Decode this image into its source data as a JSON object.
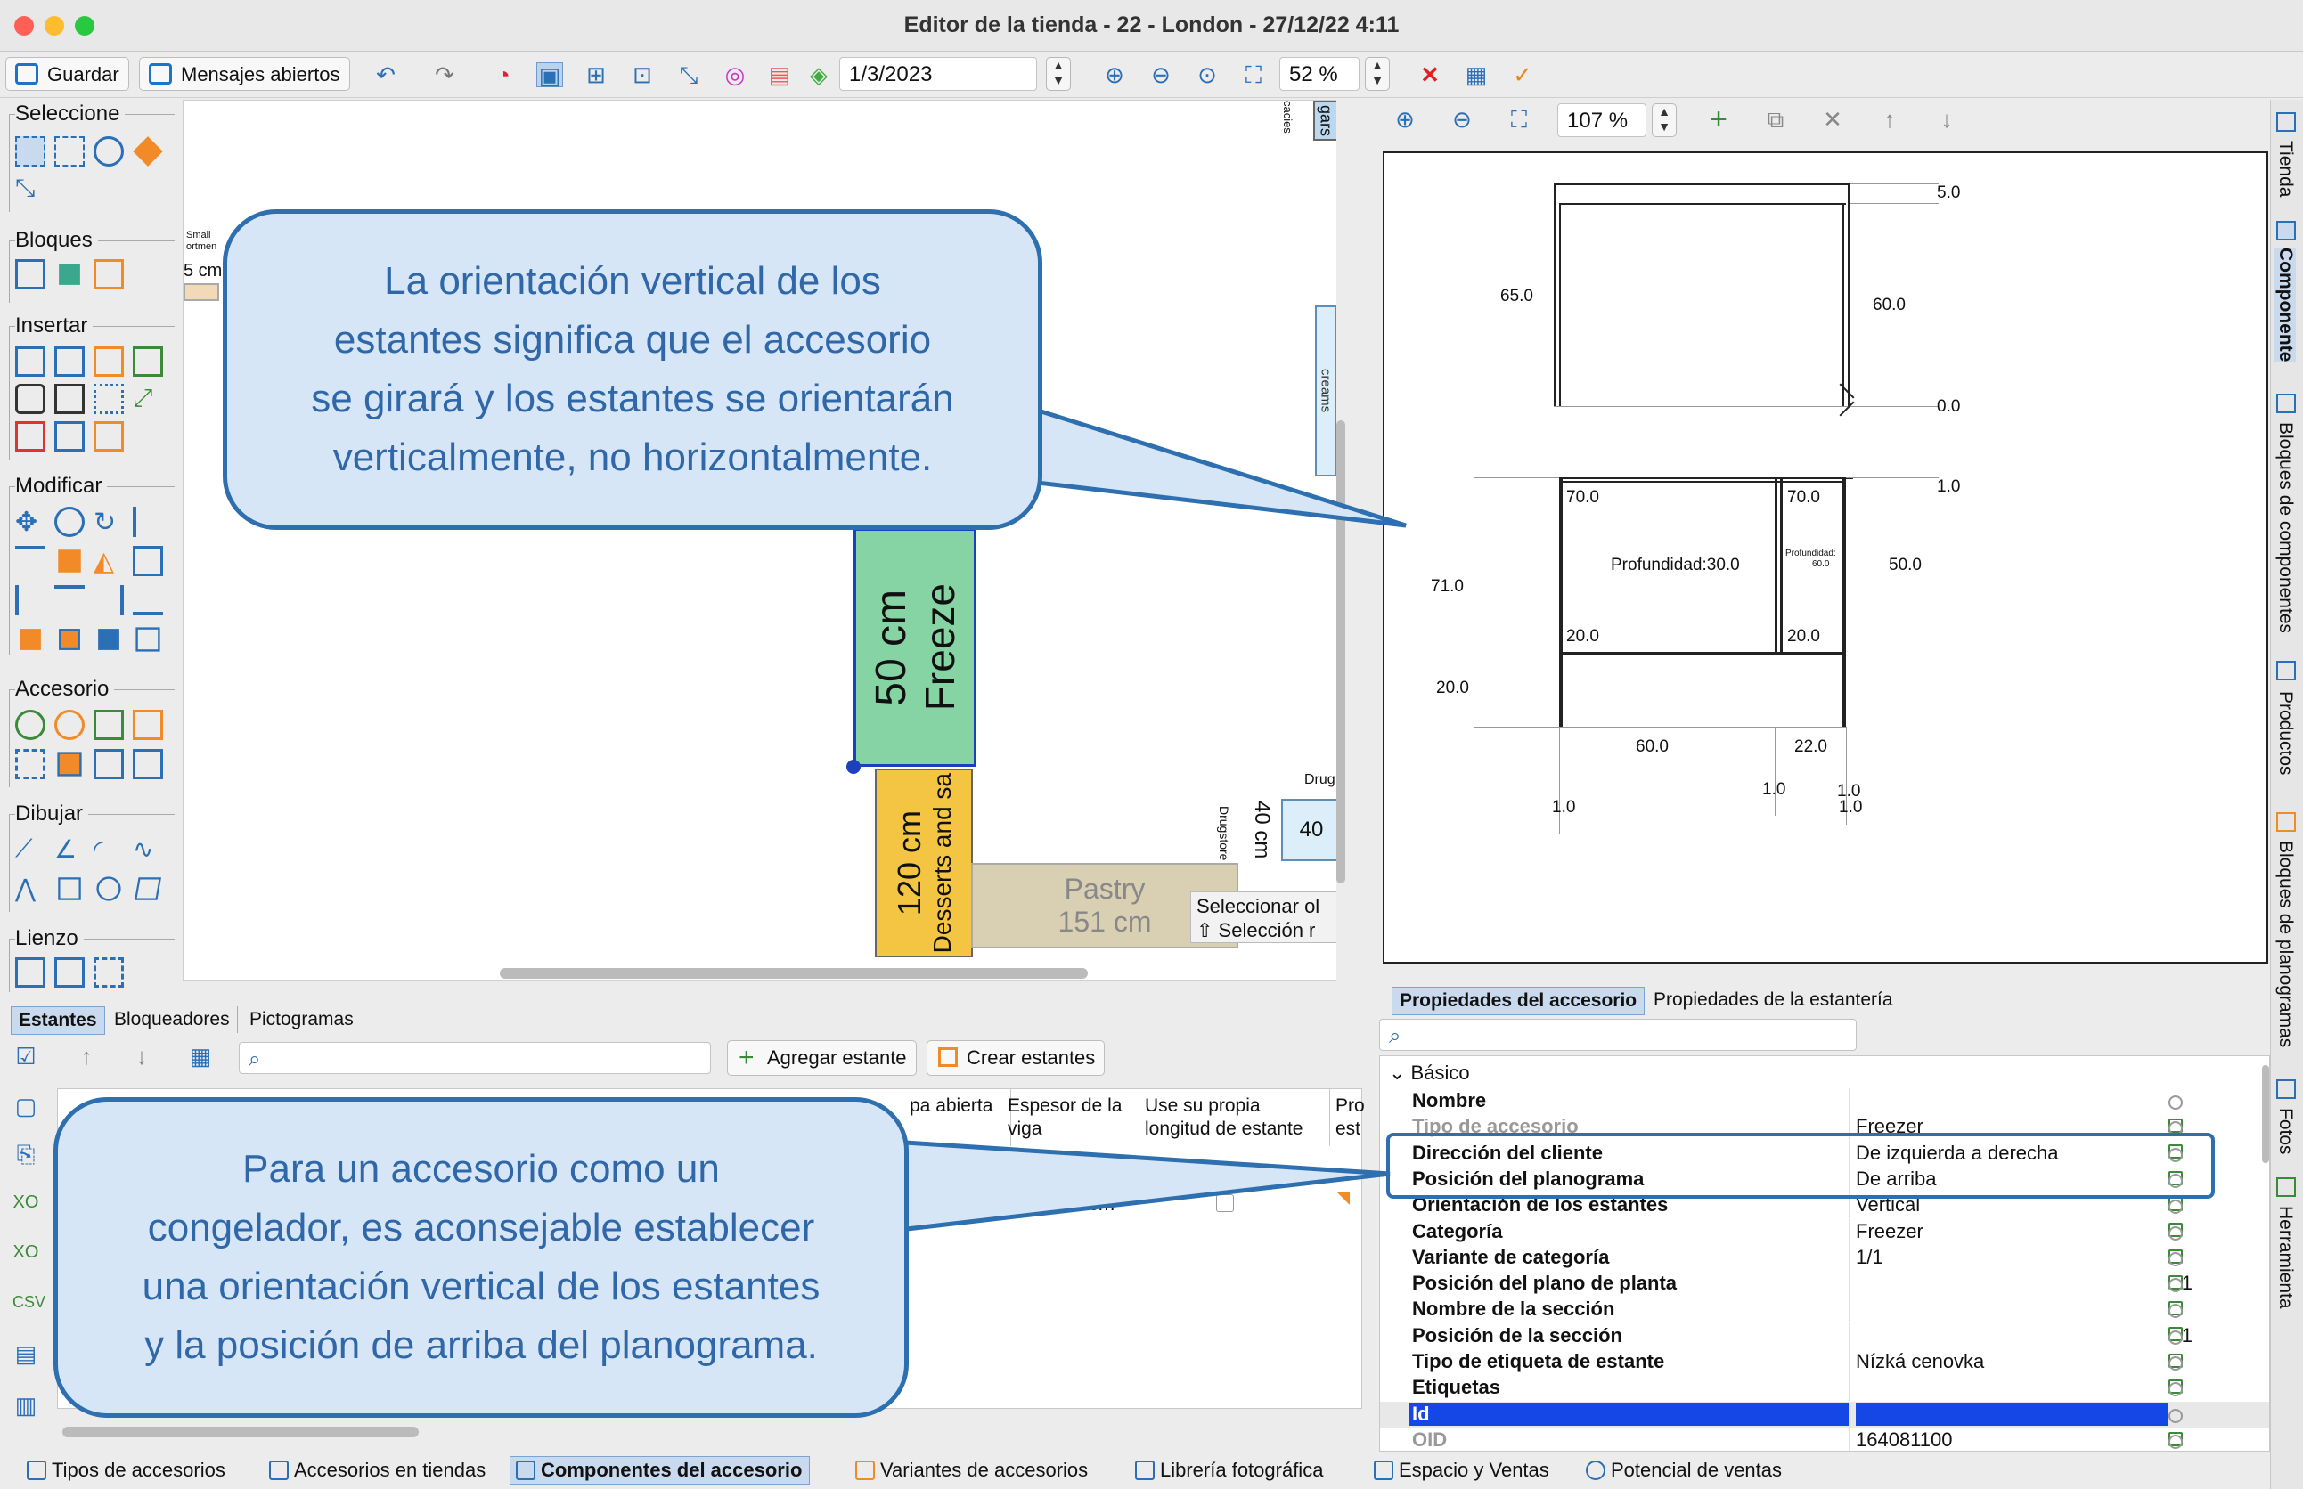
{
  "window": {
    "title": "Editor de la tienda - 22 - London - 27/12/22 4:11"
  },
  "toolbar": {
    "save": "Guardar",
    "messages": "Mensajes abiertos",
    "date": "1/3/2023",
    "zoom": "52 %"
  },
  "palette": {
    "groups": [
      "Seleccione",
      "Bloques",
      "Insertar",
      "Modificar",
      "Accesorio",
      "Dibujar",
      "Lienzo"
    ]
  },
  "canvas": {
    "labels": {
      "small": "Small",
      "ortmen": "ortmen",
      "cm5": "5 cm",
      "gars": "gars",
      "cacies": "cacies",
      "creams": "creams",
      "drug": "Drug",
      "drugstore": "Drugstore",
      "forty_cm": "40 cm",
      "forty": "40"
    },
    "freezer_len": "50 cm",
    "freezer_name": "Freeze",
    "desserts_len": "120 cm",
    "desserts_name": "Desserts and sa",
    "pastry_name": "Pastry",
    "pastry_len": "151 cm",
    "tooltip1": "Seleccionar ol",
    "tooltip2": "⇧ Selección r"
  },
  "drawing_toolbar": {
    "zoom": "107 %"
  },
  "drawing": {
    "dims": {
      "d5": "5.0",
      "d65": "65.0",
      "d60a": "60.0",
      "d0": "0.0",
      "d1a": "1.0",
      "d70a": "70.0",
      "d70b": "70.0",
      "prof30": "Profundidad:30.0",
      "prof60a": "Profundidad:",
      "prof60b": "60.0",
      "d50": "50.0",
      "d71": "71.0",
      "d20a": "20.0",
      "d20b": "20.0",
      "d20c": "20.0",
      "d60b": "60.0",
      "d22": "22.0",
      "d1b": "1.0",
      "d1c": "1.0",
      "d1d": "1.0",
      "d1e": "1.0"
    }
  },
  "side_tabs": [
    "Tienda",
    "Componente",
    "Bloques de componentes",
    "Productos",
    "Bloques de planogramas",
    "Fotos",
    "Herramienta"
  ],
  "shelves_panel": {
    "tabs": [
      "Estantes",
      "Bloqueadores",
      "Pictogramas"
    ],
    "add_shelf": "Agregar estante",
    "create_shelves": "Crear estantes",
    "headers": [
      "pa abierta",
      "Espesor de la viga",
      "Use su propia longitud de estante",
      "Pro est"
    ],
    "cell": "2.0 cm"
  },
  "props_panel": {
    "tabs": [
      "Propiedades del accesorio",
      "Propiedades de la estantería"
    ],
    "section": "Básico",
    "rows": [
      {
        "name": "Nombre",
        "value": "",
        "num": ""
      },
      {
        "name": "Tipo de accesorio",
        "value": "Freezer",
        "num": ""
      },
      {
        "name": "Dirección del cliente",
        "value": "De izquierda a derecha",
        "num": ""
      },
      {
        "name": "Posición del planograma",
        "value": "De arriba",
        "num": ""
      },
      {
        "name": "Orientación de los estantes",
        "value": "Vertical",
        "num": ""
      },
      {
        "name": "Categoría",
        "value": "Freezer",
        "num": ""
      },
      {
        "name": "Variante de categoría",
        "value": "1/1",
        "num": ""
      },
      {
        "name": "Posición del plano de planta",
        "value": "",
        "num": "1"
      },
      {
        "name": "Nombre de la sección",
        "value": "",
        "num": ""
      },
      {
        "name": "Posición de la sección",
        "value": "",
        "num": "1"
      },
      {
        "name": "Tipo de etiqueta de estante",
        "value": "Nízká cenovka",
        "num": ""
      },
      {
        "name": "Etiquetas",
        "value": "",
        "num": ""
      },
      {
        "name": "Id",
        "value": "",
        "num": ""
      },
      {
        "name": "OID",
        "value": "164081100",
        "num": ""
      }
    ]
  },
  "statusbar": [
    "Tipos de accesorios",
    "Accesorios en tiendas",
    "Componentes del accesorio",
    "Variantes de accesorios",
    "Librería fotográfica",
    "Espacio y Ventas",
    "Potencial de ventas"
  ],
  "callouts": {
    "top": [
      "La orientación vertical de los",
      "estantes significa que el accesorio",
      "se girará y los estantes se orientarán",
      "verticalmente, no horizontalmente."
    ],
    "bottom": [
      "Para un accesorio como un",
      "congelador, es aconsejable establecer",
      "una orientación vertical de los estantes",
      "y la posición de arriba del planograma."
    ]
  },
  "colors": {
    "accent": "#2e6fb0",
    "callout_fill": "#d6e6f6",
    "freezer": "#86d3a3",
    "desserts": "#f4c542",
    "pastry": "#d9cfb2",
    "selected_row": "#1447e6"
  }
}
